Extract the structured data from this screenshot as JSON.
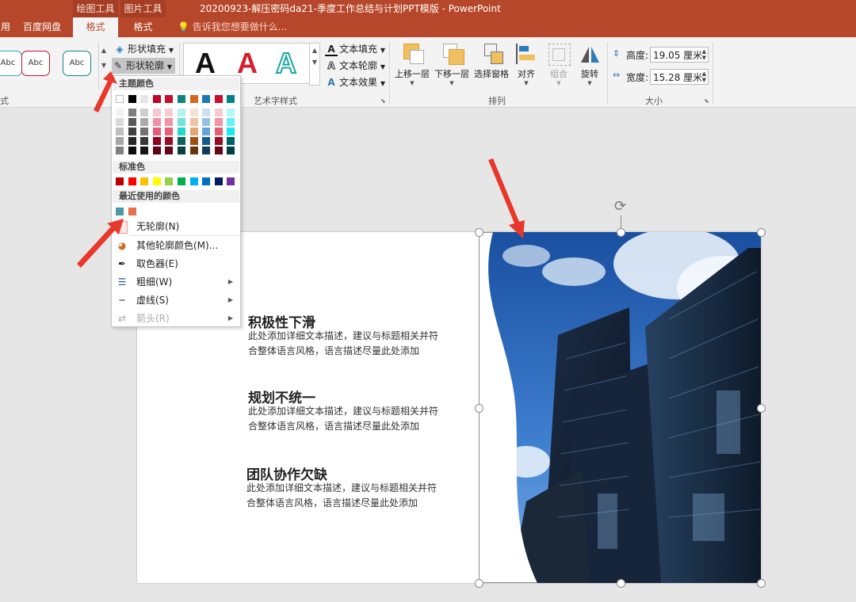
{
  "titlebar": {
    "context_tabs": [
      "绘图工具",
      "图片工具"
    ],
    "document_title": "20200923-解压密码da21-季度工作总结与计划PPT模版 - PowerPoint"
  },
  "tabs": [
    {
      "label": "用"
    },
    {
      "label": "百度网盘"
    },
    {
      "label": "格式",
      "active": true
    },
    {
      "label": "格式"
    }
  ],
  "tell_me": "告诉我您想要做什么...",
  "ribbon": {
    "shape_styles": [
      "Abc",
      "Abc",
      "Abc"
    ],
    "shape_styles_group_tail": "式",
    "shape_fill": "形状填充",
    "shape_outline": "形状轮廓",
    "wordart_group": "艺术字样式",
    "wordart_letters": [
      "A",
      "A",
      "A"
    ],
    "text_fill": "文本填充",
    "text_outline": "文本轮廓",
    "text_effects": "文本效果",
    "arrange": {
      "bring_forward": "上移一层",
      "send_backward": "下移一层",
      "selection_pane": "选择窗格",
      "align": "对齐",
      "group": "组合",
      "rotate": "旋转",
      "group_label": "排列"
    },
    "size": {
      "height_label": "高度:",
      "height_value": "19.05 厘米",
      "width_label": "宽度:",
      "width_value": "15.28 厘米",
      "group_label": "大小"
    }
  },
  "dropdown": {
    "theme_colors_title": "主题颜色",
    "theme_colors_top": [
      "#ffffff",
      "#000000",
      "#e7e6e6",
      "#c00026",
      "#c8102e",
      "#11837e",
      "#d2691e",
      "#1f78b4",
      "#c8102e",
      "#00808a"
    ],
    "theme_colors_shades": [
      [
        "#f2f2f2",
        "#d9d9d9",
        "#bfbfbf",
        "#a6a6a6",
        "#808080"
      ],
      [
        "#7f7f7f",
        "#595959",
        "#404040",
        "#262626",
        "#0d0d0d"
      ],
      [
        "#d0cece",
        "#aeaaaa",
        "#757171",
        "#3a3838",
        "#161616"
      ],
      [
        "#f8c8d2",
        "#f291a5",
        "#eb5a79",
        "#900020",
        "#600015"
      ],
      [
        "#f7cad1",
        "#ee95a3",
        "#e66075",
        "#960c22",
        "#640817"
      ],
      [
        "#b7f1ee",
        "#6fe3dc",
        "#27d5cb",
        "#0c625e",
        "#08413f"
      ],
      [
        "#f6e1d2",
        "#edc3a5",
        "#e4a578",
        "#9e4f16",
        "#69340f"
      ],
      [
        "#cce0f2",
        "#99c1e6",
        "#66a3d9",
        "#175a87",
        "#0f3c5a"
      ],
      [
        "#f7cad1",
        "#ee95a3",
        "#e66075",
        "#960c22",
        "#640817"
      ],
      [
        "#b2f7fb",
        "#66f0f8",
        "#19e8f4",
        "#006068",
        "#004045"
      ]
    ],
    "standard_title": "标准色",
    "standard_colors": [
      "#c00000",
      "#ff0000",
      "#ffc000",
      "#ffff00",
      "#92d050",
      "#00b050",
      "#00b0f0",
      "#0070c0",
      "#002060",
      "#7030a0"
    ],
    "recent_title": "最近使用的颜色",
    "recent_colors": [
      "#4a9aa6",
      "#e8704a"
    ],
    "no_outline": "无轮廓(N)",
    "more_colors": "其他轮廓颜色(M)...",
    "eyedropper": "取色器(E)",
    "weight": "粗细(W)",
    "dashes": "虚线(S)",
    "arrows": "箭头(R)"
  },
  "slide": {
    "items": [
      {
        "title": "积极性下滑",
        "desc": "此处添加详细文本描述，建议与标题相关并符合整体语言风格，语言描述尽量此处添加",
        "color": "#e8704a",
        "icon": "trophy-icon"
      },
      {
        "title": "规划不统一",
        "desc": "此处添加详细文本描述，建议与标题相关并符合整体语言风格，语言描述尽量此处添加",
        "color": "#4a9aa6",
        "icon": "qr-code-icon"
      },
      {
        "title": "团队协作欠缺",
        "desc": "此处添加详细文本描述，建议与标题相关并符合整体语言风格，语言描述尽量此处添加",
        "color": "#e8704a",
        "icon": "pushpin-icon"
      }
    ]
  }
}
